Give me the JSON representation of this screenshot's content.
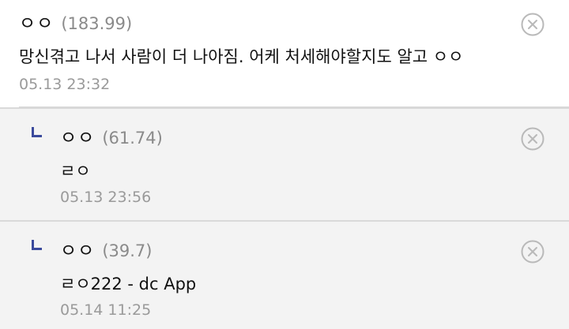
{
  "colors": {
    "reply_background": "#f3f3f3",
    "reply_marker": "#3b4a9c",
    "score_text": "#8a8a8a",
    "timestamp_text": "#9a9a9a",
    "delete_icon": "#b9b9b9"
  },
  "comments": [
    {
      "author": "ㅇㅇ",
      "score": "(183.99)",
      "text": "망신겪고 나서 사람이 더 나아짐. 어케 처세해야할지도 알고 ㅇㅇ",
      "timestamp": "05.13 23:32",
      "delete_icon": "circle-x-icon"
    }
  ],
  "replies": [
    {
      "marker_icon": "reply-arrow-icon",
      "author": "ㅇㅇ",
      "score": "(61.74)",
      "text": "ㄹㅇ",
      "timestamp": "05.13 23:56",
      "delete_icon": "circle-x-icon"
    },
    {
      "marker_icon": "reply-arrow-icon",
      "author": "ㅇㅇ",
      "score": "(39.7)",
      "text": "ㄹㅇ222 - dc App",
      "timestamp": "05.14 11:25",
      "delete_icon": "circle-x-icon"
    }
  ]
}
